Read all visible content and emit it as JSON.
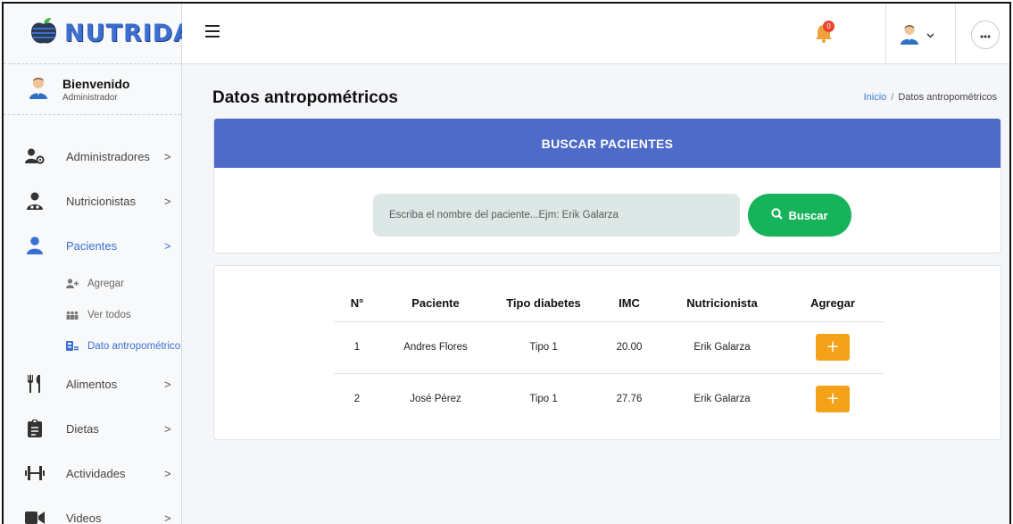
{
  "brand": {
    "name": "NUTRIDAY"
  },
  "user": {
    "greeting": "Bienvenido",
    "role": "Administrador"
  },
  "sidebar": {
    "items": [
      {
        "label": "Administradores",
        "icon": "user-gear-icon",
        "chevron": ">"
      },
      {
        "label": "Nutricionistas",
        "icon": "user-doctor-icon",
        "chevron": ">"
      },
      {
        "label": "Pacientes",
        "icon": "user-icon",
        "chevron": ">",
        "active": true
      },
      {
        "label": "Alimentos",
        "icon": "utensils-icon",
        "chevron": ">"
      },
      {
        "label": "Dietas",
        "icon": "clipboard-icon",
        "chevron": ">"
      },
      {
        "label": "Actividades",
        "icon": "dumbbell-icon",
        "chevron": ">"
      },
      {
        "label": "Videos",
        "icon": "video-icon",
        "chevron": ">"
      }
    ],
    "subitems": [
      {
        "label": "Agregar",
        "icon": "user-plus-icon"
      },
      {
        "label": "Ver todos",
        "icon": "users-icon"
      },
      {
        "label": "Dato antropométrico",
        "icon": "id-card-icon",
        "active": true
      }
    ]
  },
  "topbar": {
    "notification_count": "0"
  },
  "page": {
    "title": "Datos antropométricos",
    "breadcrumb": {
      "home": "Inicio",
      "separator": "/",
      "current": "Datos antropométricos"
    }
  },
  "search": {
    "heading": "BUSCAR PACIENTES",
    "placeholder": "Escriba el nombre del paciente...Ejm: Erik Galarza",
    "button_label": "Buscar"
  },
  "table": {
    "headers": [
      "N°",
      "Paciente",
      "Tipo diabetes",
      "IMC",
      "Nutricionista",
      "Agregar"
    ],
    "rows": [
      {
        "n": "1",
        "paciente": "Andres Flores",
        "tipo": "Tipo 1",
        "imc": "20.00",
        "nutricionista": "Erik Galarza",
        "add": "+"
      },
      {
        "n": "2",
        "paciente": "José Pérez",
        "tipo": "Tipo 1",
        "imc": "27.76",
        "nutricionista": "Erik Galarza",
        "add": "+"
      }
    ]
  },
  "colors": {
    "brand": "#3c6fd0",
    "accent": "#4e6bc8",
    "search_button": "#17b35b",
    "add_button": "#f5a21b",
    "active_link": "#3b6fd4",
    "notification": "#e8452e"
  }
}
